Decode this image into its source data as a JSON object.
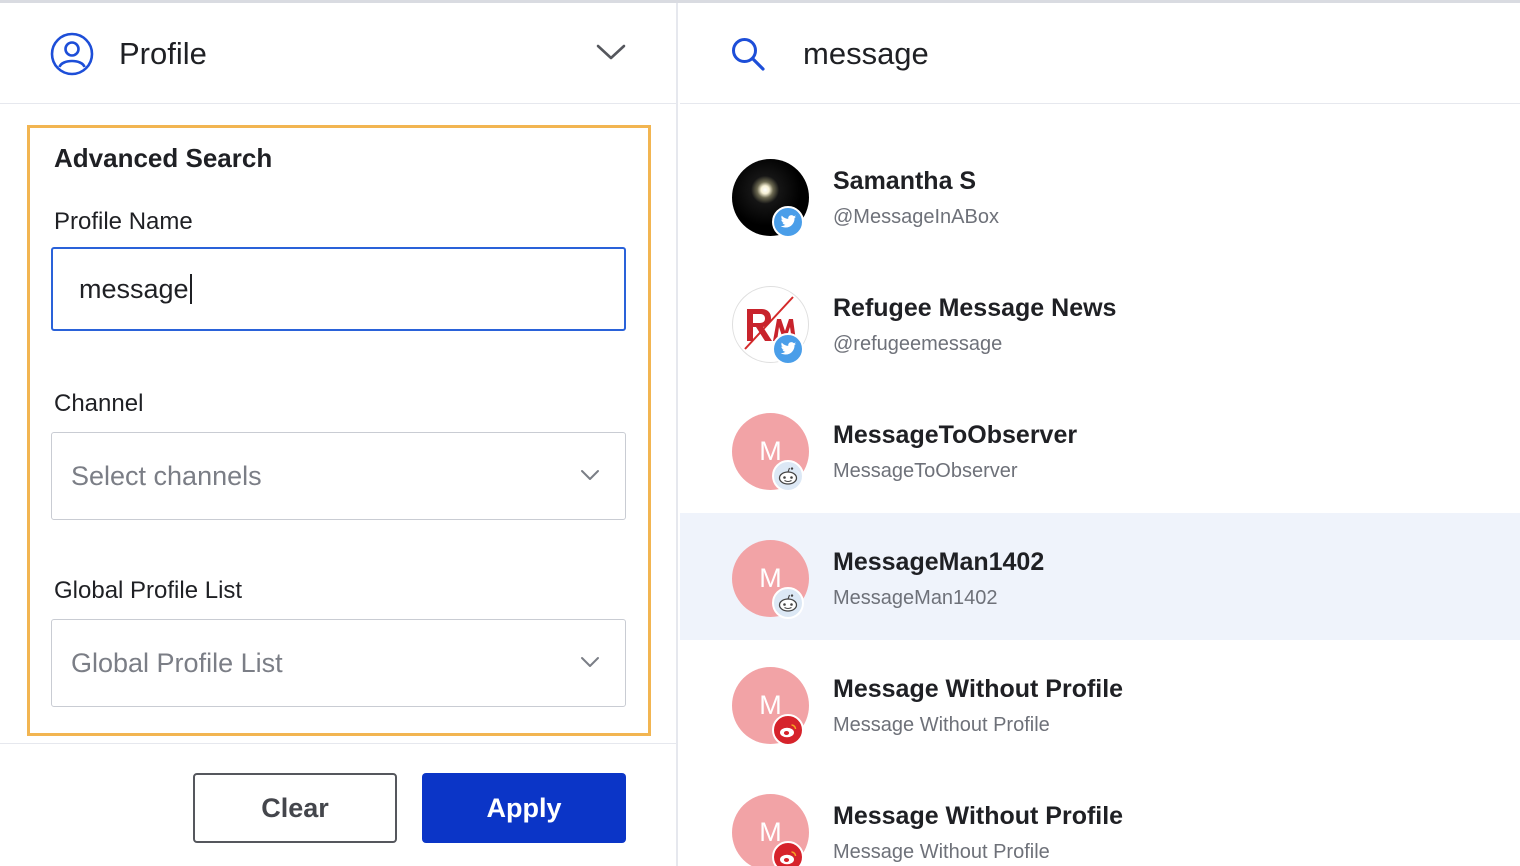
{
  "header": {
    "profile_label": "Profile"
  },
  "search": {
    "query": "message"
  },
  "advanced_search": {
    "title": "Advanced Search",
    "profile_name_label": "Profile Name",
    "profile_name_value": "message",
    "channel_label": "Channel",
    "channel_placeholder": "Select channels",
    "global_list_label": "Global Profile List",
    "global_list_placeholder": "Global Profile List"
  },
  "buttons": {
    "clear": "Clear",
    "apply": "Apply"
  },
  "colors": {
    "accent": "#0b35c7",
    "highlight_border": "#f2b551",
    "selected_row": "#eff3fb",
    "avatar_placeholder": "#f2a3a6"
  },
  "results": [
    {
      "name": "Samantha S",
      "handle": "@MessageInABox",
      "avatar": "image-dark",
      "channel_icon": "twitter-icon"
    },
    {
      "name": "Refugee Message News",
      "handle": "@refugeemessage",
      "avatar": "image-logo",
      "channel_icon": "twitter-icon"
    },
    {
      "name": "MessageToObserver",
      "handle": "MessageToObserver",
      "avatar_letter": "M",
      "channel_icon": "reddit-icon"
    },
    {
      "name": "MessageMan1402",
      "handle": "MessageMan1402",
      "avatar_letter": "M",
      "channel_icon": "reddit-icon",
      "selected": true
    },
    {
      "name": "Message Without Profile",
      "handle": "Message Without Profile",
      "avatar_letter": "M",
      "channel_icon": "weibo-icon"
    },
    {
      "name": "Message Without Profile",
      "handle": "Message Without Profile",
      "avatar_letter": "M",
      "channel_icon": "weibo-icon"
    }
  ]
}
